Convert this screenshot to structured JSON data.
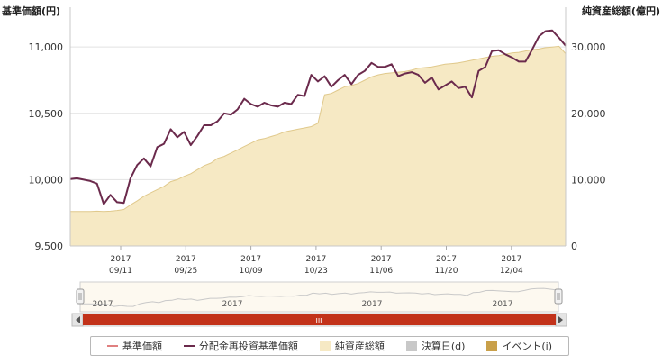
{
  "left_axis_title": "基準価額(円)",
  "right_axis_title": "純資産総額(億円)",
  "colors": {
    "nav_line": "#6b2a4c",
    "base_line": "#e08080",
    "assets_fill": "#f6e9c4",
    "assets_stroke": "#e0c98c",
    "settlement": "#c8c8c8",
    "event": "#c9a04a",
    "scrollbar": "#c2321a"
  },
  "chart_data": {
    "type": "line",
    "x_date_labels": [
      {
        "year": "2017",
        "date": "09/11"
      },
      {
        "year": "2017",
        "date": "09/25"
      },
      {
        "year": "2017",
        "date": "10/09"
      },
      {
        "year": "2017",
        "date": "10/23"
      },
      {
        "year": "2017",
        "date": "11/06"
      },
      {
        "year": "2017",
        "date": "11/20"
      },
      {
        "year": "2017",
        "date": "12/04"
      }
    ],
    "y_left_ticks": [
      "9,500",
      "10,000",
      "10,500",
      "11,000"
    ],
    "y_left_range": [
      9500,
      11000
    ],
    "y_right_ticks": [
      "0",
      "10,000",
      "20,000",
      "30,000"
    ],
    "y_right_range": [
      0,
      30000
    ],
    "series": [
      {
        "name": "分配金再投資基準価額",
        "axis": "left",
        "values": [
          10005,
          10010,
          10000,
          9990,
          9970,
          9815,
          9885,
          9830,
          9825,
          10010,
          10110,
          10160,
          10100,
          10245,
          10270,
          10380,
          10320,
          10360,
          10260,
          10330,
          10410,
          10410,
          10440,
          10500,
          10490,
          10530,
          10610,
          10570,
          10550,
          10580,
          10560,
          10550,
          10580,
          10570,
          10640,
          10630,
          10790,
          10740,
          10780,
          10700,
          10750,
          10790,
          10720,
          10790,
          10820,
          10880,
          10850,
          10850,
          10870,
          10780,
          10800,
          10810,
          10790,
          10730,
          10770,
          10680,
          10710,
          10740,
          10690,
          10700,
          10620,
          10820,
          10850,
          10970,
          10975,
          10945,
          10920,
          10890,
          10890,
          10980,
          11080,
          11120,
          11125,
          11070,
          11010
        ]
      },
      {
        "name": "純資産総額",
        "axis": "right",
        "values": [
          5200,
          5200,
          5200,
          5200,
          5250,
          5200,
          5250,
          5350,
          5500,
          6200,
          6800,
          7500,
          8000,
          8500,
          9000,
          9700,
          10000,
          10500,
          10900,
          11500,
          12100,
          12500,
          13200,
          13500,
          14000,
          14500,
          15000,
          15500,
          16000,
          16200,
          16500,
          16800,
          17200,
          17400,
          17600,
          17800,
          18000,
          18500,
          22800,
          23000,
          23500,
          24000,
          24200,
          24500,
          25000,
          25500,
          25800,
          26000,
          26100,
          26200,
          26300,
          26500,
          26800,
          26900,
          27000,
          27200,
          27400,
          27500,
          27600,
          27800,
          28000,
          28200,
          28400,
          28600,
          28700,
          28900,
          29100,
          29200,
          29400,
          29600,
          29700,
          29900,
          30000,
          30100,
          29000
        ]
      }
    ],
    "navigator_labels": [
      "2017",
      "2017",
      "2017",
      "2017"
    ],
    "scrollbar_label": "III"
  },
  "legend": [
    {
      "label": "基準価額",
      "type": "line",
      "color_key": "base_line"
    },
    {
      "label": "分配金再投資基準価額",
      "type": "line",
      "color_key": "nav_line"
    },
    {
      "label": "純資産総額",
      "type": "box",
      "color_key": "assets_fill"
    },
    {
      "label": "決算日(d)",
      "type": "box",
      "color_key": "settlement"
    },
    {
      "label": "イベント(i)",
      "type": "box",
      "color_key": "event"
    }
  ]
}
